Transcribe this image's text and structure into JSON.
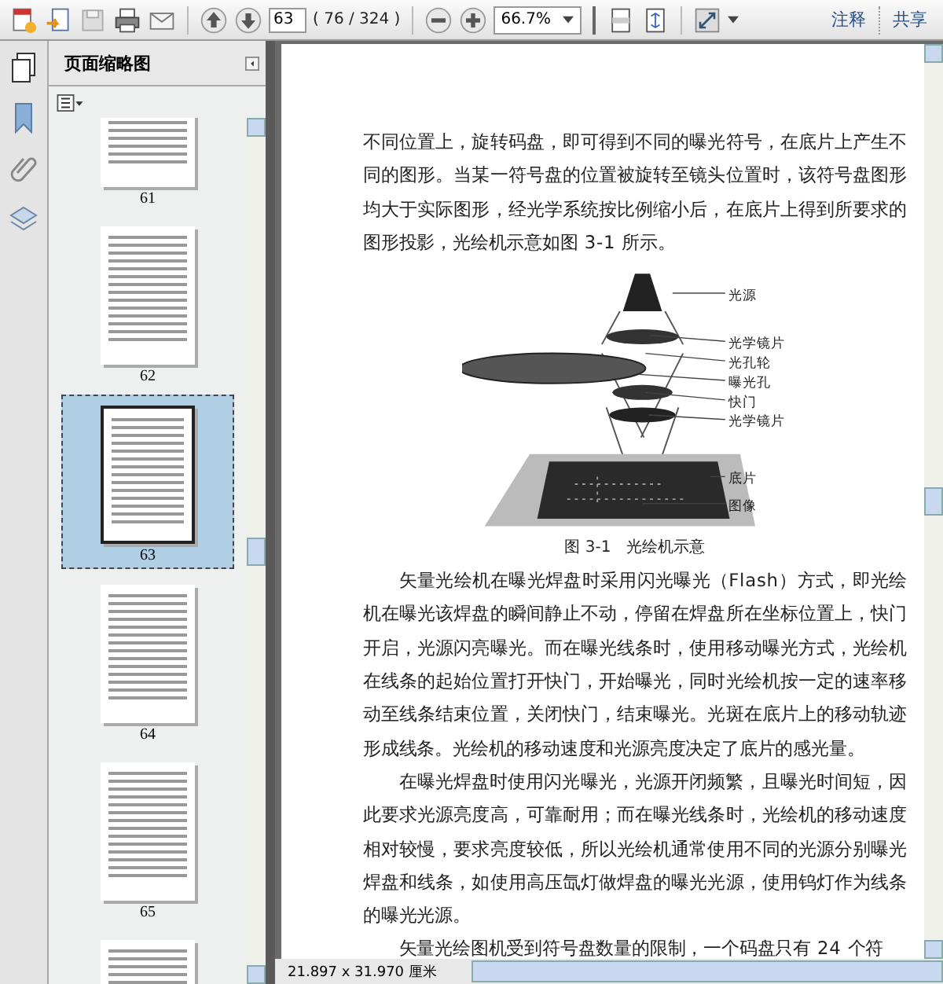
{
  "toolbar": {
    "page_field": "63",
    "page_count": "( 76 / 324 )",
    "zoom_field": "66.7%",
    "links": [
      "注释",
      "共享"
    ]
  },
  "sidebar": {
    "title": "页面缩略图",
    "thumbnails": [
      {
        "label": "61",
        "selected": false
      },
      {
        "label": "62",
        "selected": false
      },
      {
        "label": "63",
        "selected": true
      },
      {
        "label": "64",
        "selected": false
      },
      {
        "label": "65",
        "selected": false
      }
    ]
  },
  "document": {
    "paragraphs": [
      {
        "text": "不同位置上，旋转码盘，即可得到不同的曝光符号，在底片上产生不同的图形。当某一符号盘的位置被旋转至镜头位置时，该符号盘图形均大于实际图形，经光学系统按比例缩小后，在底片上得到所要求的图形投影，光绘机示意如图 3-1 所示。",
        "indent": false
      },
      {
        "text": "矢量光绘机在曝光焊盘时采用闪光曝光（Flash）方式，即光绘机在曝光该焊盘的瞬间静止不动，停留在焊盘所在坐标位置上，快门开启，光源闪亮曝光。而在曝光线条时，使用移动曝光方式，光绘机在线条的起始位置打开快门，开始曝光，同时光绘机按一定的速率移动至线条结束位置，关闭快门，结束曝光。光斑在底片上的移动轨迹形成线条。光绘机的移动速度和光源亮度决定了底片的感光量。",
        "indent": true
      },
      {
        "text": "在曝光焊盘时使用闪光曝光，光源开闭频繁，且曝光时间短，因此要求光源亮度高，可靠耐用；而在曝光线条时，光绘机的移动速度相对较慢，要求亮度较低，所以光绘机通常使用不同的光源分别曝光焊盘和线条，如使用高压氙灯做焊盘的曝光光源，使用钨灯作为线条的曝光光源。",
        "indent": true
      },
      {
        "text": "矢量光绘图机受到符号盘数量的限制，一个码盘只有 24 个符",
        "indent": true
      }
    ],
    "figure": {
      "labels": [
        "光源",
        "光学镜片",
        "光孔轮",
        "曝光孔",
        "快门",
        "光学镜片",
        "底片",
        "图像"
      ],
      "caption": "图 3-1　光绘机示意"
    }
  },
  "status_bar": {
    "page_size": "21.897 x 31.970 厘米"
  }
}
